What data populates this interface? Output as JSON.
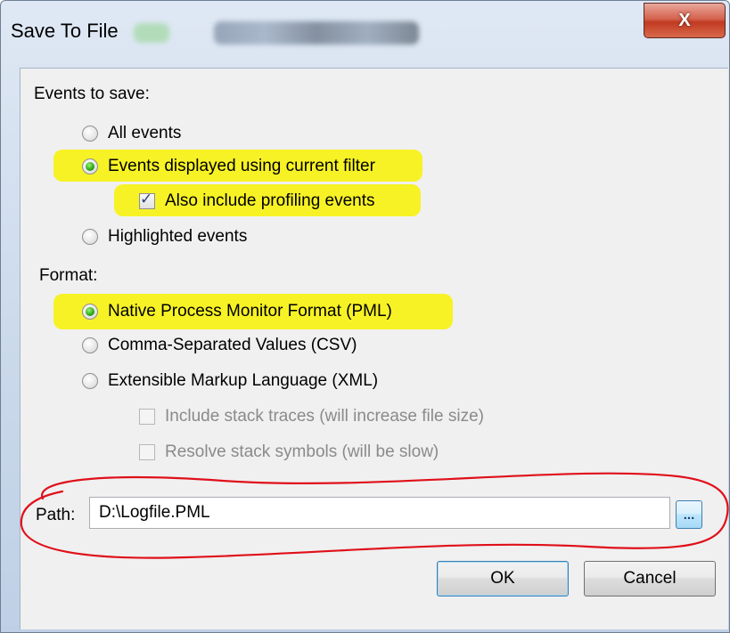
{
  "window": {
    "title": "Save To File",
    "close_glyph": "X"
  },
  "events": {
    "heading": "Events to save:",
    "options": [
      {
        "label": "All events",
        "checked": false
      },
      {
        "label": "Events displayed using current filter",
        "checked": true
      },
      {
        "label": "Highlighted events",
        "checked": false
      }
    ],
    "profiling": {
      "label": "Also include profiling events",
      "checked": true
    }
  },
  "format": {
    "heading": "Format:",
    "options": [
      {
        "label": "Native Process Monitor Format (PML)",
        "checked": true
      },
      {
        "label": "Comma-Separated Values (CSV)",
        "checked": false
      },
      {
        "label": "Extensible Markup Language (XML)",
        "checked": false
      }
    ],
    "xml_options": [
      {
        "label": "Include stack traces (will increase file size)",
        "checked": false,
        "enabled": false
      },
      {
        "label": "Resolve stack symbols (will be slow)",
        "checked": false,
        "enabled": false
      }
    ]
  },
  "path": {
    "label": "Path:",
    "value": "D:\\Logfile.PML",
    "browse_label": "..."
  },
  "buttons": {
    "ok": "OK",
    "cancel": "Cancel"
  },
  "colors": {
    "highlight": "#f7f225",
    "annotation": "#e0101a",
    "radio_checked": "#2fae16"
  }
}
